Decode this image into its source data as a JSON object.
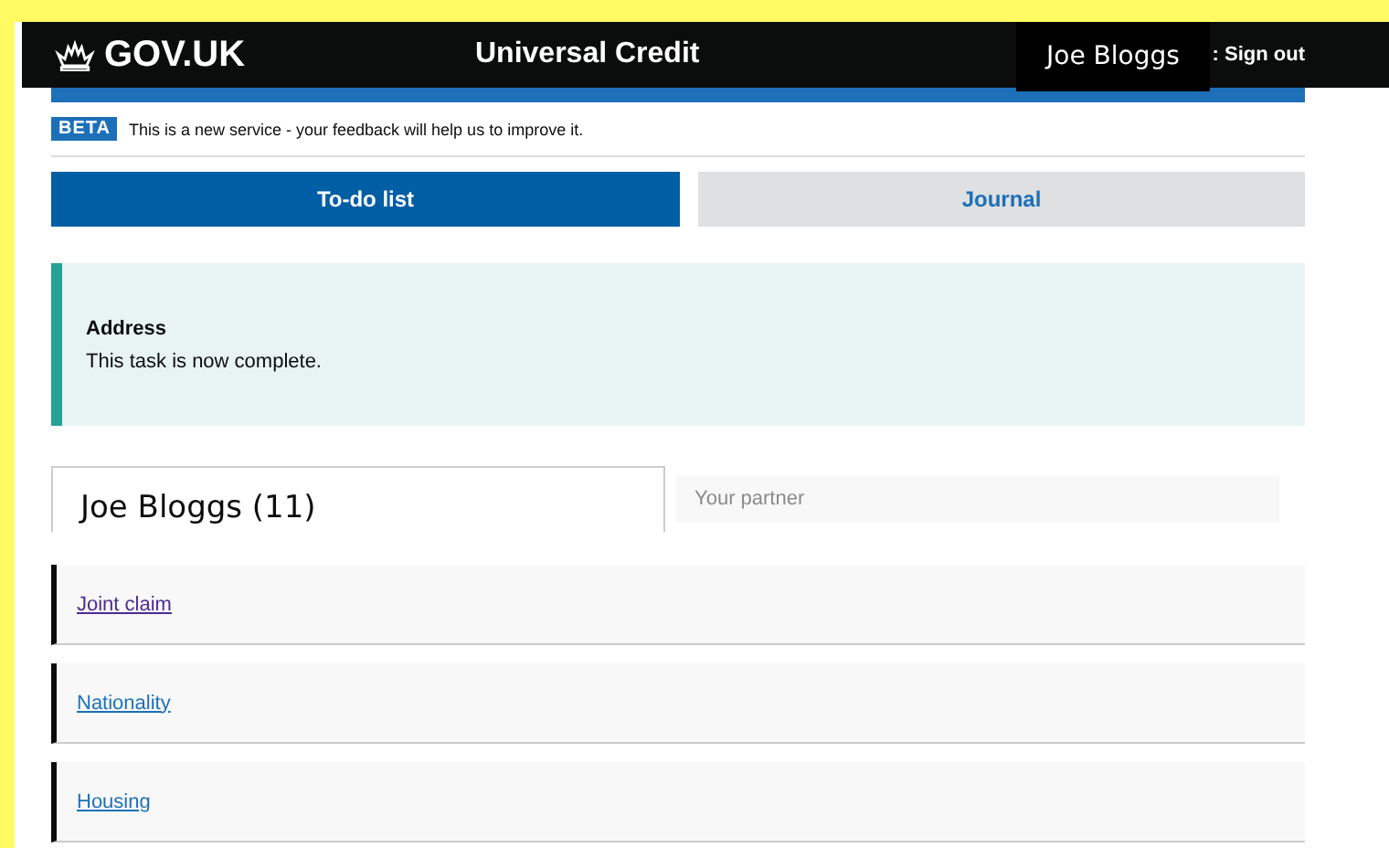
{
  "header": {
    "logo": "GOV.UK",
    "service": "Universal Credit",
    "account": ": Sign out",
    "overlay_name": "Joe Bloggs"
  },
  "phase_banner": {
    "tag": "BETA",
    "text": "This is a new service - your feedback will help us to improve it."
  },
  "tabs": [
    {
      "label": "To-do list",
      "selected": true
    },
    {
      "label": "Journal",
      "selected": false
    }
  ],
  "notice": {
    "title": "Address",
    "text": "This task is now complete."
  },
  "person_tabs": [
    {
      "label": "Joe Bloggs (11)",
      "selected": true
    },
    {
      "label": "Your partner",
      "selected": false
    }
  ],
  "tasks": [
    {
      "label": "Joint claim",
      "visited": true
    },
    {
      "label": "Nationality",
      "visited": false
    },
    {
      "label": "Housing",
      "visited": false
    }
  ]
}
